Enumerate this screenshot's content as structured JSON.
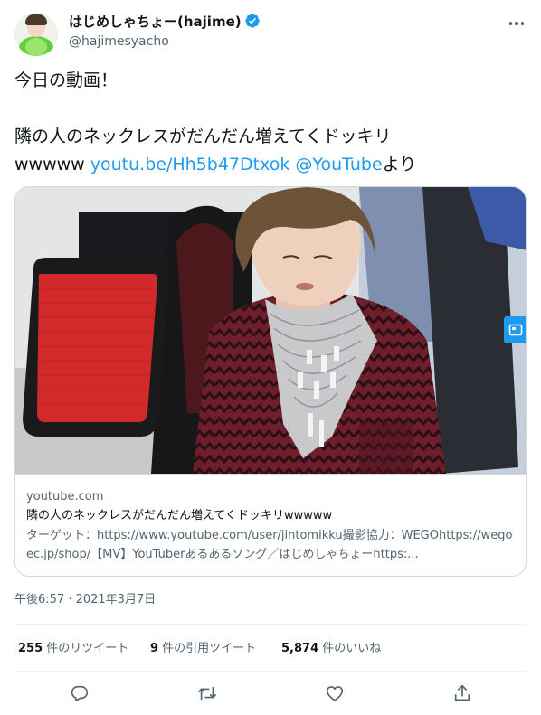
{
  "author": {
    "display_name": "はじめしゃちょー(hajime)",
    "handle": "@hajimesyacho",
    "verified_color": "#1d9bf0"
  },
  "tweet": {
    "line1": "今日の動画！",
    "line2": "隣の人のネックレスがだんだん増えてくドッキリ",
    "line3_prefix": "wwwww ",
    "link_url": "youtu.be/Hh5b47Dtxok",
    "mention": "@YouTube",
    "line3_suffix": "より"
  },
  "card": {
    "domain": "youtube.com",
    "title": "隣の人のネックレスがだんだん増えてくドッキリwwwww",
    "description": "ターゲット：https://www.youtube.com/user/jintomikku撮影協力：WEGOhttps://wegoec.jp/shop/【MV】YouTuberあるあるソング／はじめしゃちょーhttps:...",
    "badge_icon": "media-icon"
  },
  "timestamp": "午後6:57 · 2021年3月7日",
  "stats": {
    "retweets_count": "255",
    "retweets_label": " 件のリツイート",
    "quotes_count": "9",
    "quotes_label": " 件の引用ツイート",
    "likes_count": "5,874",
    "likes_label": " 件のいいね"
  },
  "actions": [
    "reply-icon",
    "retweet-icon",
    "like-icon",
    "share-icon"
  ],
  "colors": {
    "accent": "#1d9bf0",
    "text": "#0f1419",
    "secondary": "#536471",
    "border": "#cfd9de"
  }
}
